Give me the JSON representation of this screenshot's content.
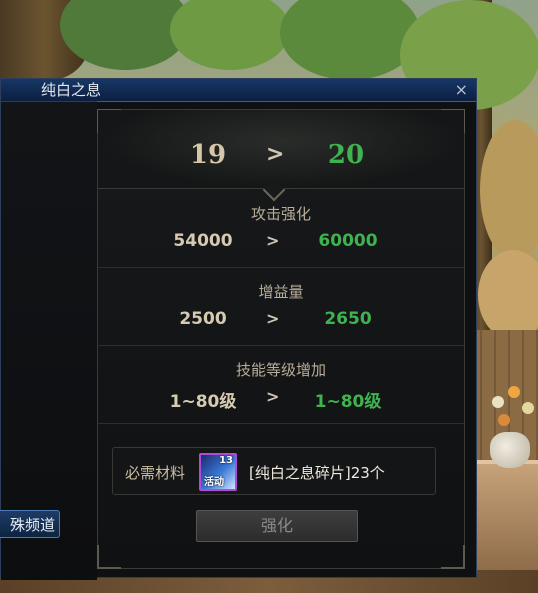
{
  "window": {
    "title": "纯白之息",
    "close_symbol": "×"
  },
  "level": {
    "from": "19",
    "arrow": ">",
    "to": "20"
  },
  "stats": [
    {
      "label": "攻击强化",
      "from": "54000",
      "arrow": ">",
      "to": "60000"
    },
    {
      "label": "增益量",
      "from": "2500",
      "arrow": ">",
      "to": "2650"
    },
    {
      "label": "技能等级增加",
      "from": "1~80级",
      "arrow": ">",
      "to": "1~80级"
    }
  ],
  "material": {
    "label": "必需材料",
    "icon_count": "13",
    "icon_tag": "活动",
    "name": "[纯白之息碎片]23个"
  },
  "enhance_button": "强化",
  "side": {
    "channel_button": "殊频道"
  },
  "colors": {
    "upgrade_green": "#3fb34f",
    "title_bar": "#173766"
  }
}
